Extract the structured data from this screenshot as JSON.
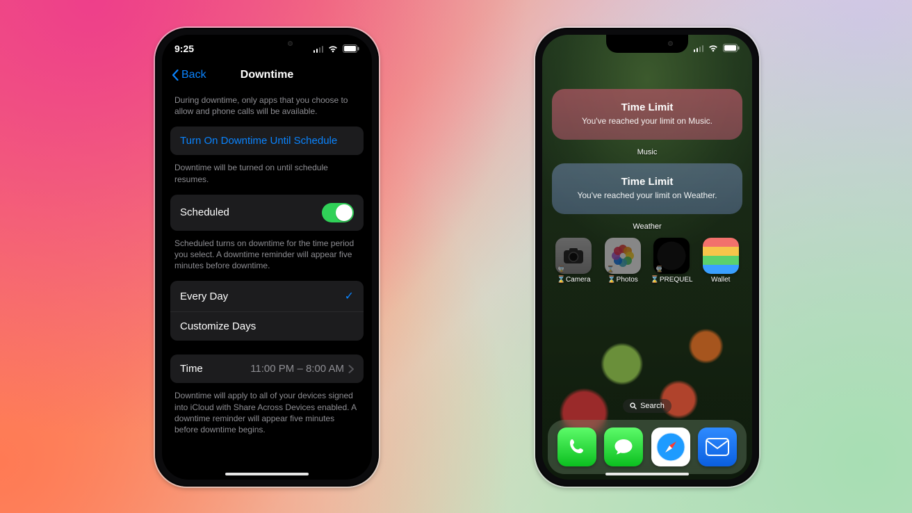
{
  "colors": {
    "accent": "#0a84ff",
    "toggle_on": "#30d158"
  },
  "left": {
    "status": {
      "time": "9:25"
    },
    "nav": {
      "back": "Back",
      "title": "Downtime"
    },
    "intro": "During downtime, only apps that you choose to allow and phone calls will be available.",
    "turn_on": {
      "label": "Turn On Downtime Until Schedule",
      "footer": "Downtime will be turned on until schedule resumes."
    },
    "scheduled": {
      "label": "Scheduled",
      "on": true,
      "footer": "Scheduled turns on downtime for the time period you select. A downtime reminder will appear five minutes before downtime."
    },
    "days": {
      "every_day": "Every Day",
      "every_day_selected": true,
      "customize": "Customize Days"
    },
    "time": {
      "label": "Time",
      "value": "11:00 PM – 8:00 AM"
    },
    "device_footer": "Downtime will apply to all of your devices signed into iCloud with Share Across Devices enabled. A downtime reminder will appear five minutes before downtime begins."
  },
  "right": {
    "widgets": [
      {
        "title": "Time Limit",
        "subtitle": "You've reached your limit on Music.",
        "caption": "Music"
      },
      {
        "title": "Time Limit",
        "subtitle": "You've reached your limit on Weather.",
        "caption": "Weather"
      }
    ],
    "apps": [
      {
        "label": "Camera",
        "locked": true
      },
      {
        "label": "Photos",
        "locked": true
      },
      {
        "label": "PREQUEL",
        "locked": true
      },
      {
        "label": "Wallet",
        "locked": false
      }
    ],
    "search": "Search",
    "dock": [
      "Phone",
      "Messages",
      "Safari",
      "Mail"
    ]
  }
}
